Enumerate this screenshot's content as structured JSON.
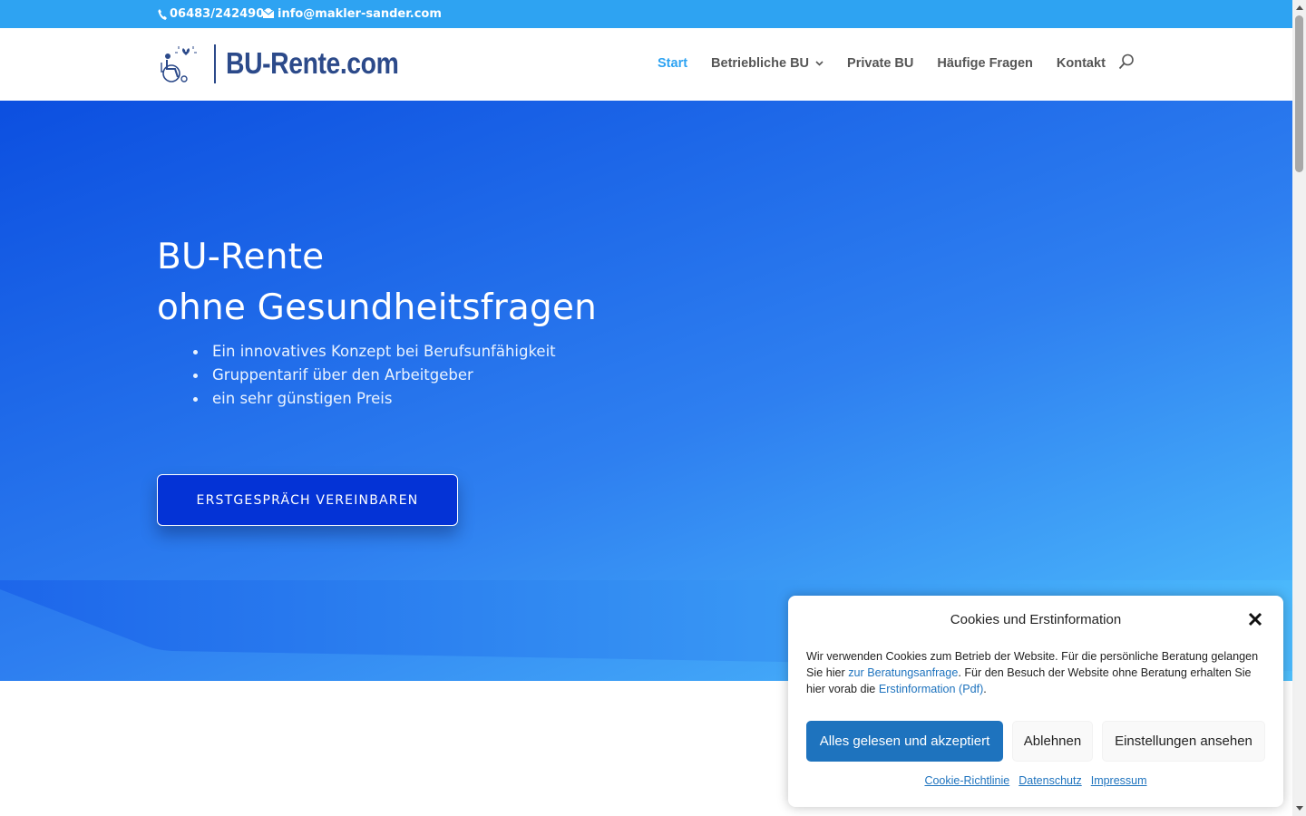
{
  "topbar": {
    "phone": "06483/2424900",
    "email": "info@makler-sander.com"
  },
  "header": {
    "logo_text": "BU-Rente.com",
    "nav": [
      {
        "label": "Start",
        "active": true
      },
      {
        "label": "Betriebliche BU",
        "has_dropdown": true
      },
      {
        "label": "Private BU"
      },
      {
        "label": "Häufige Fragen"
      },
      {
        "label": "Kontakt"
      }
    ]
  },
  "hero": {
    "title_line1": "BU-Rente",
    "title_line2": "ohne Gesundheitsfragen",
    "bullets": [
      "Ein innovatives Konzept bei Berufsunfähigkeit",
      "Gruppentarif über den Arbeitgeber",
      "ein sehr günstigen Preis"
    ],
    "cta_label": "ERSTGESPRÄCH VEREINBAREN"
  },
  "cookie": {
    "title": "Cookies und Erstinformation",
    "text_1": "Wir verwenden Cookies zum Betrieb der Website. Für die persönliche Beratung gelangen Sie hier ",
    "link_1": "zur Beratungsanfrage",
    "text_2": ". Für den Besuch der Website ohne Beratung erhalten Sie hier vorab die ",
    "link_2": "Erstinformation (Pdf)",
    "text_3": ".",
    "accept_label": "Alles gelesen und akzeptiert",
    "deny_label": "Ablehnen",
    "settings_label": "Einstellungen ansehen",
    "footer_links": [
      "Cookie-Richtlinie",
      "Datenschutz",
      "Impressum"
    ]
  },
  "colors": {
    "topbar": "#2ea3f2",
    "logo": "#2c4a8a",
    "nav_active": "#2ea3f2",
    "hero_start": "#0c4fe0",
    "hero_end": "#4fc0fd",
    "cta_bg": "#0433d6",
    "cookie_accept": "#1e73be"
  }
}
